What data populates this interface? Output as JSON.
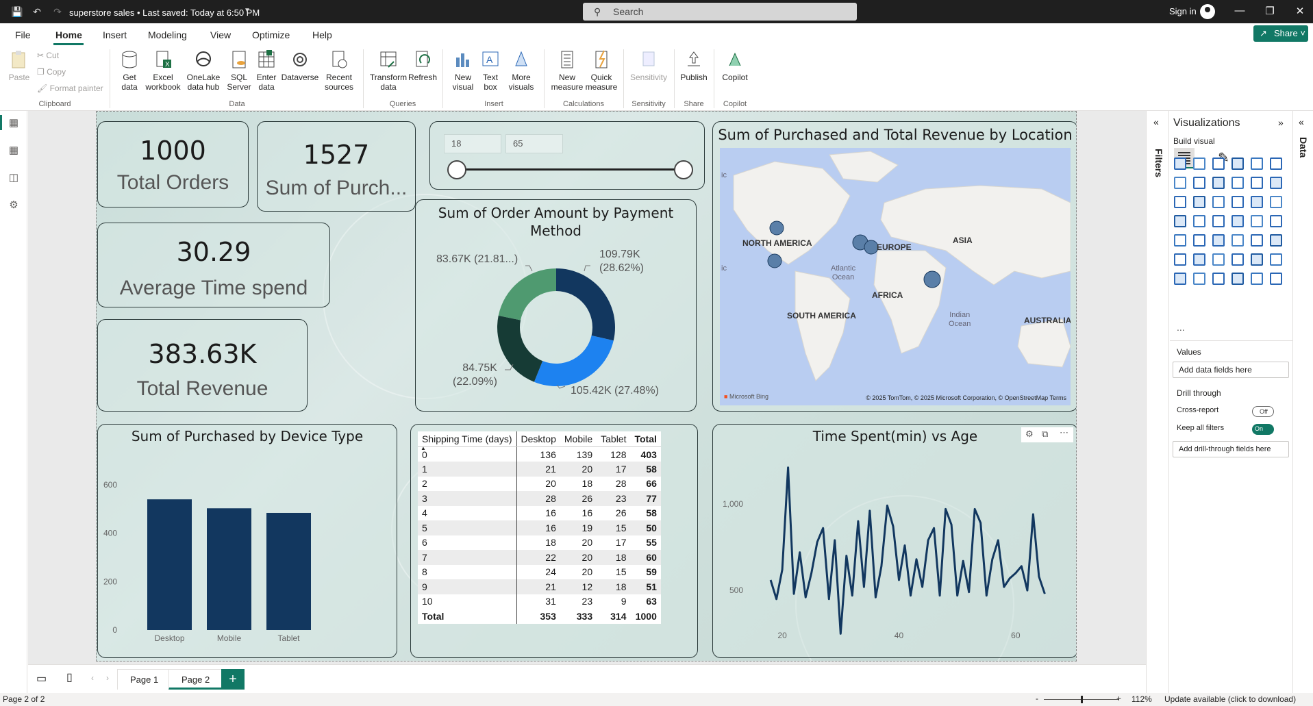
{
  "titlebar": {
    "title": "superstore sales • Last saved: Today at 6:50 PM",
    "search": "Search",
    "signin": "Sign in"
  },
  "menu": {
    "items": [
      "File",
      "Home",
      "Insert",
      "Modeling",
      "View",
      "Optimize",
      "Help"
    ],
    "share": "Share"
  },
  "ribbon": {
    "clipboard": {
      "paste": "Paste",
      "cut": "Cut",
      "copy": "Copy",
      "format_painter": "Format painter",
      "group": "Clipboard"
    },
    "data": {
      "get_data": "Get data",
      "excel": "Excel workbook",
      "onelake": "OneLake data hub",
      "sql": "SQL Server",
      "enter": "Enter data",
      "dataverse": "Dataverse",
      "recent": "Recent sources",
      "group": "Data"
    },
    "queries": {
      "transform": "Transform data",
      "refresh": "Refresh",
      "group": "Queries"
    },
    "insert": {
      "new_visual": "New visual",
      "text_box": "Text box",
      "more_visuals": "More visuals",
      "group": "Insert"
    },
    "calculations": {
      "new_measure": "New measure",
      "quick_measure": "Quick measure",
      "group": "Calculations"
    },
    "sensitivity": {
      "label": "Sensitivity",
      "group": "Sensitivity"
    },
    "share": {
      "publish": "Publish",
      "group": "Share"
    },
    "copilot": {
      "label": "Copilot",
      "group": "Copilot"
    }
  },
  "kpis": [
    {
      "value": "1000",
      "label": "Total Orders"
    },
    {
      "value": "1527",
      "label": "Sum of Purch..."
    },
    {
      "value": "30.29",
      "label": "Average Time spend"
    },
    {
      "value": "383.63K",
      "label": "Total Revenue"
    }
  ],
  "slider": {
    "min": "18",
    "max": "65"
  },
  "donut": {
    "title": "Sum of Order Amount by Payment Method",
    "slices": [
      {
        "label": "109.79K",
        "pct": "(28.62%)",
        "value": 109.79,
        "color": "#12375f"
      },
      {
        "label": "105.42K (27.48%)",
        "value": 105.42,
        "color": "#1d82f0"
      },
      {
        "label": "84.75K",
        "pct": "(22.09%)",
        "value": 84.75,
        "color": "#163b35"
      },
      {
        "label": "83.67K (21.81...)",
        "value": 83.67,
        "color": "#4f9a70"
      }
    ]
  },
  "map": {
    "title": "Sum of Purchased and Total Revenue by Location",
    "labels": [
      "NORTH AMERICA",
      "EUROPE",
      "ASIA",
      "Atlantic",
      "Ocean",
      "AFRICA",
      "SOUTH AMERICA",
      "Indian",
      "Ocean",
      "AUSTRALIA",
      "ic",
      "ic"
    ],
    "credit": "© 2025 TomTom, © 2025 Microsoft Corporation, © OpenStreetMap  Terms",
    "logo": "Microsoft Bing"
  },
  "bar_card": {
    "title": "Sum of Purchased by Device Type"
  },
  "matrix": {
    "headers": [
      "Shipping Time (days)",
      "Desktop",
      "Mobile",
      "Tablet",
      "Total"
    ],
    "rows": [
      [
        "0",
        "136",
        "139",
        "128",
        "403"
      ],
      [
        "1",
        "21",
        "20",
        "17",
        "58"
      ],
      [
        "2",
        "20",
        "18",
        "28",
        "66"
      ],
      [
        "3",
        "28",
        "26",
        "23",
        "77"
      ],
      [
        "4",
        "16",
        "16",
        "26",
        "58"
      ],
      [
        "5",
        "16",
        "19",
        "15",
        "50"
      ],
      [
        "6",
        "18",
        "20",
        "17",
        "55"
      ],
      [
        "7",
        "22",
        "20",
        "18",
        "60"
      ],
      [
        "8",
        "24",
        "20",
        "15",
        "59"
      ],
      [
        "9",
        "21",
        "12",
        "18",
        "51"
      ],
      [
        "10",
        "31",
        "23",
        "9",
        "63"
      ]
    ],
    "total": [
      "Total",
      "353",
      "333",
      "314",
      "1000"
    ]
  },
  "line_card": {
    "title": "Time Spent(min) vs Age"
  },
  "chart_data": [
    {
      "type": "bar",
      "title": "Sum of Purchased by Device Type",
      "categories": [
        "Desktop",
        "Mobile",
        "Tablet"
      ],
      "values": [
        540,
        503,
        484
      ],
      "yticks": [
        "0",
        "200",
        "400",
        "600"
      ],
      "ylim": [
        0,
        600
      ],
      "color": "#12375f"
    },
    {
      "type": "pie",
      "title": "Sum of Order Amount by Payment Method",
      "categories": [
        "109.79K (28.62%)",
        "105.42K (27.48%)",
        "84.75K (22.09%)",
        "83.67K (21.81...)"
      ],
      "values": [
        109.79,
        105.42,
        84.75,
        83.67
      ]
    },
    {
      "type": "line",
      "title": "Time Spent(min) vs Age",
      "x": [
        18,
        19,
        20,
        21,
        22,
        23,
        24,
        25,
        26,
        27,
        28,
        29,
        30,
        31,
        32,
        33,
        34,
        35,
        36,
        37,
        38,
        39,
        40,
        41,
        42,
        43,
        44,
        45,
        46,
        47,
        48,
        49,
        50,
        51,
        52,
        53,
        54,
        55,
        56,
        57,
        58,
        59,
        60,
        61,
        62,
        63,
        64,
        65
      ],
      "y": [
        560,
        450,
        620,
        1210,
        480,
        720,
        460,
        600,
        780,
        860,
        450,
        790,
        250,
        700,
        470,
        900,
        520,
        960,
        460,
        640,
        990,
        870,
        560,
        760,
        470,
        680,
        520,
        790,
        860,
        470,
        970,
        880,
        470,
        670,
        490,
        970,
        890,
        470,
        680,
        790,
        520,
        570,
        600,
        640,
        500,
        940,
        580,
        480
      ],
      "xticks": [
        "20",
        "40",
        "60"
      ],
      "yticks": [
        "500",
        "1,000"
      ],
      "ylim": [
        200,
        1300
      ],
      "xlim": [
        14,
        68
      ],
      "color": "#12375f"
    }
  ],
  "viz_pane": {
    "title": "Visualizations",
    "build": "Build visual",
    "values": "Values",
    "add_fields": "Add data fields here",
    "drill": "Drill through",
    "cross": "Cross-report",
    "cross_state": "Off",
    "keep": "Keep all filters",
    "keep_state": "On",
    "add_drill": "Add drill-through fields here",
    "filters": "Filters",
    "data": "Data",
    "more": "..."
  },
  "pages": {
    "tabs": [
      "Page 1",
      "Page 2"
    ],
    "add": "+"
  },
  "status": {
    "page": "Page 2 of 2",
    "zoom": "112%",
    "update": "Update available (click to download)",
    "minus": "-",
    "plus": "+"
  }
}
